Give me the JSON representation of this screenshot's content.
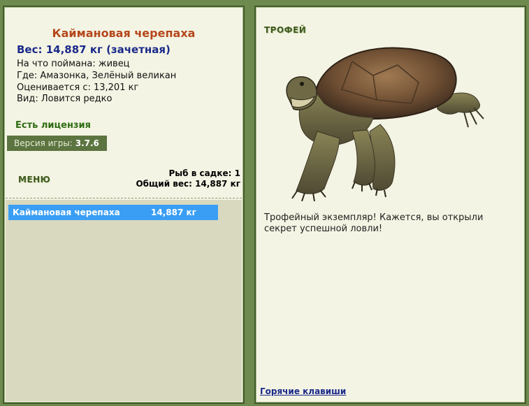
{
  "fish": {
    "name": "Каймановая черепаха",
    "weight_line": "Вес: 14,887 кг (зачетная)",
    "caught_on": "На что поймана: живец",
    "location": "Где: Амазонка, Зелёный великан",
    "valued_at": "Оценивается с: 13,201 кг",
    "species": "Вид: Ловится редко"
  },
  "license": "Есть лицензия",
  "version": {
    "label": "Версия игры:",
    "value": "3.7.6"
  },
  "menu_label": "МЕНЮ",
  "keep_net": {
    "count_line": "Рыб в садке: 1",
    "total_line": "Общий вес: 14,887 кг"
  },
  "catch_list": [
    {
      "name": "Каймановая черепаха",
      "weight": "14,887 кг"
    }
  ],
  "trophy": {
    "label": "ТРОФЕЙ",
    "text": "Трофейный экземпляр! Кажется, вы открыли секрет успешной ловли!"
  },
  "hotkeys_label": "Горячие клавиши"
}
